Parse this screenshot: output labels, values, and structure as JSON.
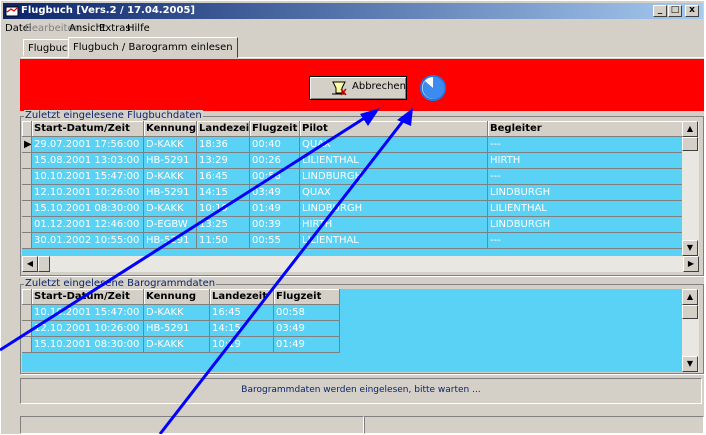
{
  "window": {
    "title": "Flugbuch [Vers.2 / 17.04.2005]",
    "min": "_",
    "max": "□",
    "close": "x"
  },
  "menu": [
    "Datei",
    "Bearbeiten",
    "Ansicht",
    "Extras",
    "Hilfe"
  ],
  "menu_disabled_index": 1,
  "tabs": [
    "Flugbuch",
    "Flugbuch / Barogramm einlesen"
  ],
  "active_tab": 1,
  "cancel_button": "Abbrechen",
  "colors": {
    "toolbar_bg": "#ff0000",
    "grid_bg": "#5ad2f5",
    "arrow": "#0000ff"
  },
  "flights": {
    "title": "Zuletzt eingelesene Flugbuchdaten",
    "columns": [
      "Start-Datum/Zeit",
      "Kennung",
      "Landezeit",
      "Flugzeit",
      "Pilot",
      "Begleiter"
    ],
    "rows": [
      [
        "29.07.2001 17:56:00",
        "D-KAKK",
        "18:36",
        "00:40",
        "QUAX",
        "---"
      ],
      [
        "15.08.2001 13:03:00",
        "HB-5291",
        "13:29",
        "00:26",
        "LILIENTHAL",
        "HIRTH"
      ],
      [
        "10.10.2001 15:47:00",
        "D-KAKK",
        "16:45",
        "00:58",
        "LINDBURGH",
        "---"
      ],
      [
        "12.10.2001 10:26:00",
        "HB-5291",
        "14:15",
        "03:49",
        "QUAX",
        "LINDBURGH"
      ],
      [
        "15.10.2001 08:30:00",
        "D-KAKK",
        "10:19",
        "01:49",
        "LINDBURGH",
        "LILIENTHAL"
      ],
      [
        "01.12.2001 12:46:00",
        "D-EGBW",
        "13:25",
        "00:39",
        "HIRTH",
        "LINDBURGH"
      ],
      [
        "30.01.2002 10:55:00",
        "HB-5291",
        "11:50",
        "00:55",
        "LILIENTHAL",
        "---"
      ]
    ]
  },
  "barograms": {
    "title": "Zuletzt eingelesene Barogrammdaten",
    "columns": [
      "Start-Datum/Zeit",
      "Kennung",
      "Landezeit",
      "Flugzeit"
    ],
    "rows": [
      [
        "10.10.2001 15:47:00",
        "D-KAKK",
        "16:45",
        "00:58"
      ],
      [
        "12.10.2001 10:26:00",
        "HB-5291",
        "14:15",
        "03:49"
      ],
      [
        "15.10.2001 08:30:00",
        "D-KAKK",
        "10:19",
        "01:49"
      ]
    ]
  },
  "status_message": "Barogrammdaten werden eingelesen, bitte warten ..."
}
